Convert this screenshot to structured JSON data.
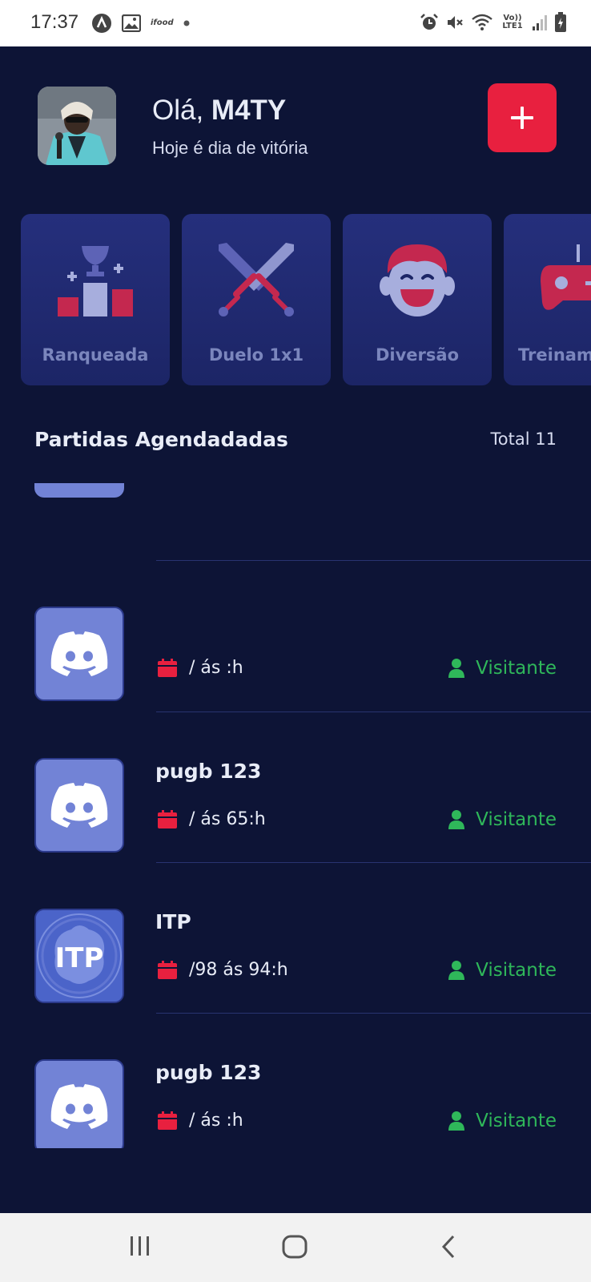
{
  "status_bar": {
    "time": "17:37",
    "app_label": "ifood",
    "network_label": "Vo)) LTE1"
  },
  "header": {
    "greeting_prefix": "Olá, ",
    "username": "M4TY",
    "subtitle": "Hoje é dia de vitória",
    "add_button_symbol": "+"
  },
  "categories": [
    {
      "label": "Ranqueada",
      "icon": "podium-trophy-icon"
    },
    {
      "label": "Duelo 1x1",
      "icon": "crossed-swords-icon"
    },
    {
      "label": "Diversão",
      "icon": "laughing-face-icon"
    },
    {
      "label": "Treinam",
      "icon": "gamepad-icon"
    }
  ],
  "section": {
    "title": "Partidas Agendadadas",
    "total": "Total 11"
  },
  "matches": [
    {
      "title": "",
      "date": "/ ás :h",
      "role": "Visitante",
      "thumb": "discord"
    },
    {
      "title": "pugb 123",
      "date": "/ ás 65:h",
      "role": "Visitante",
      "thumb": "discord"
    },
    {
      "title": "ITP",
      "date": "/98 ás 94:h",
      "role": "Visitante",
      "thumb": "itp",
      "thumb_text": "ITP"
    },
    {
      "title": "pugb 123",
      "date": "/ ás :h",
      "role": "Visitante",
      "thumb": "discord"
    }
  ],
  "colors": {
    "background": "#0d1436",
    "accent_red": "#e8203f",
    "visitor_green": "#2fb75a",
    "discord_blue": "#7283d6"
  }
}
